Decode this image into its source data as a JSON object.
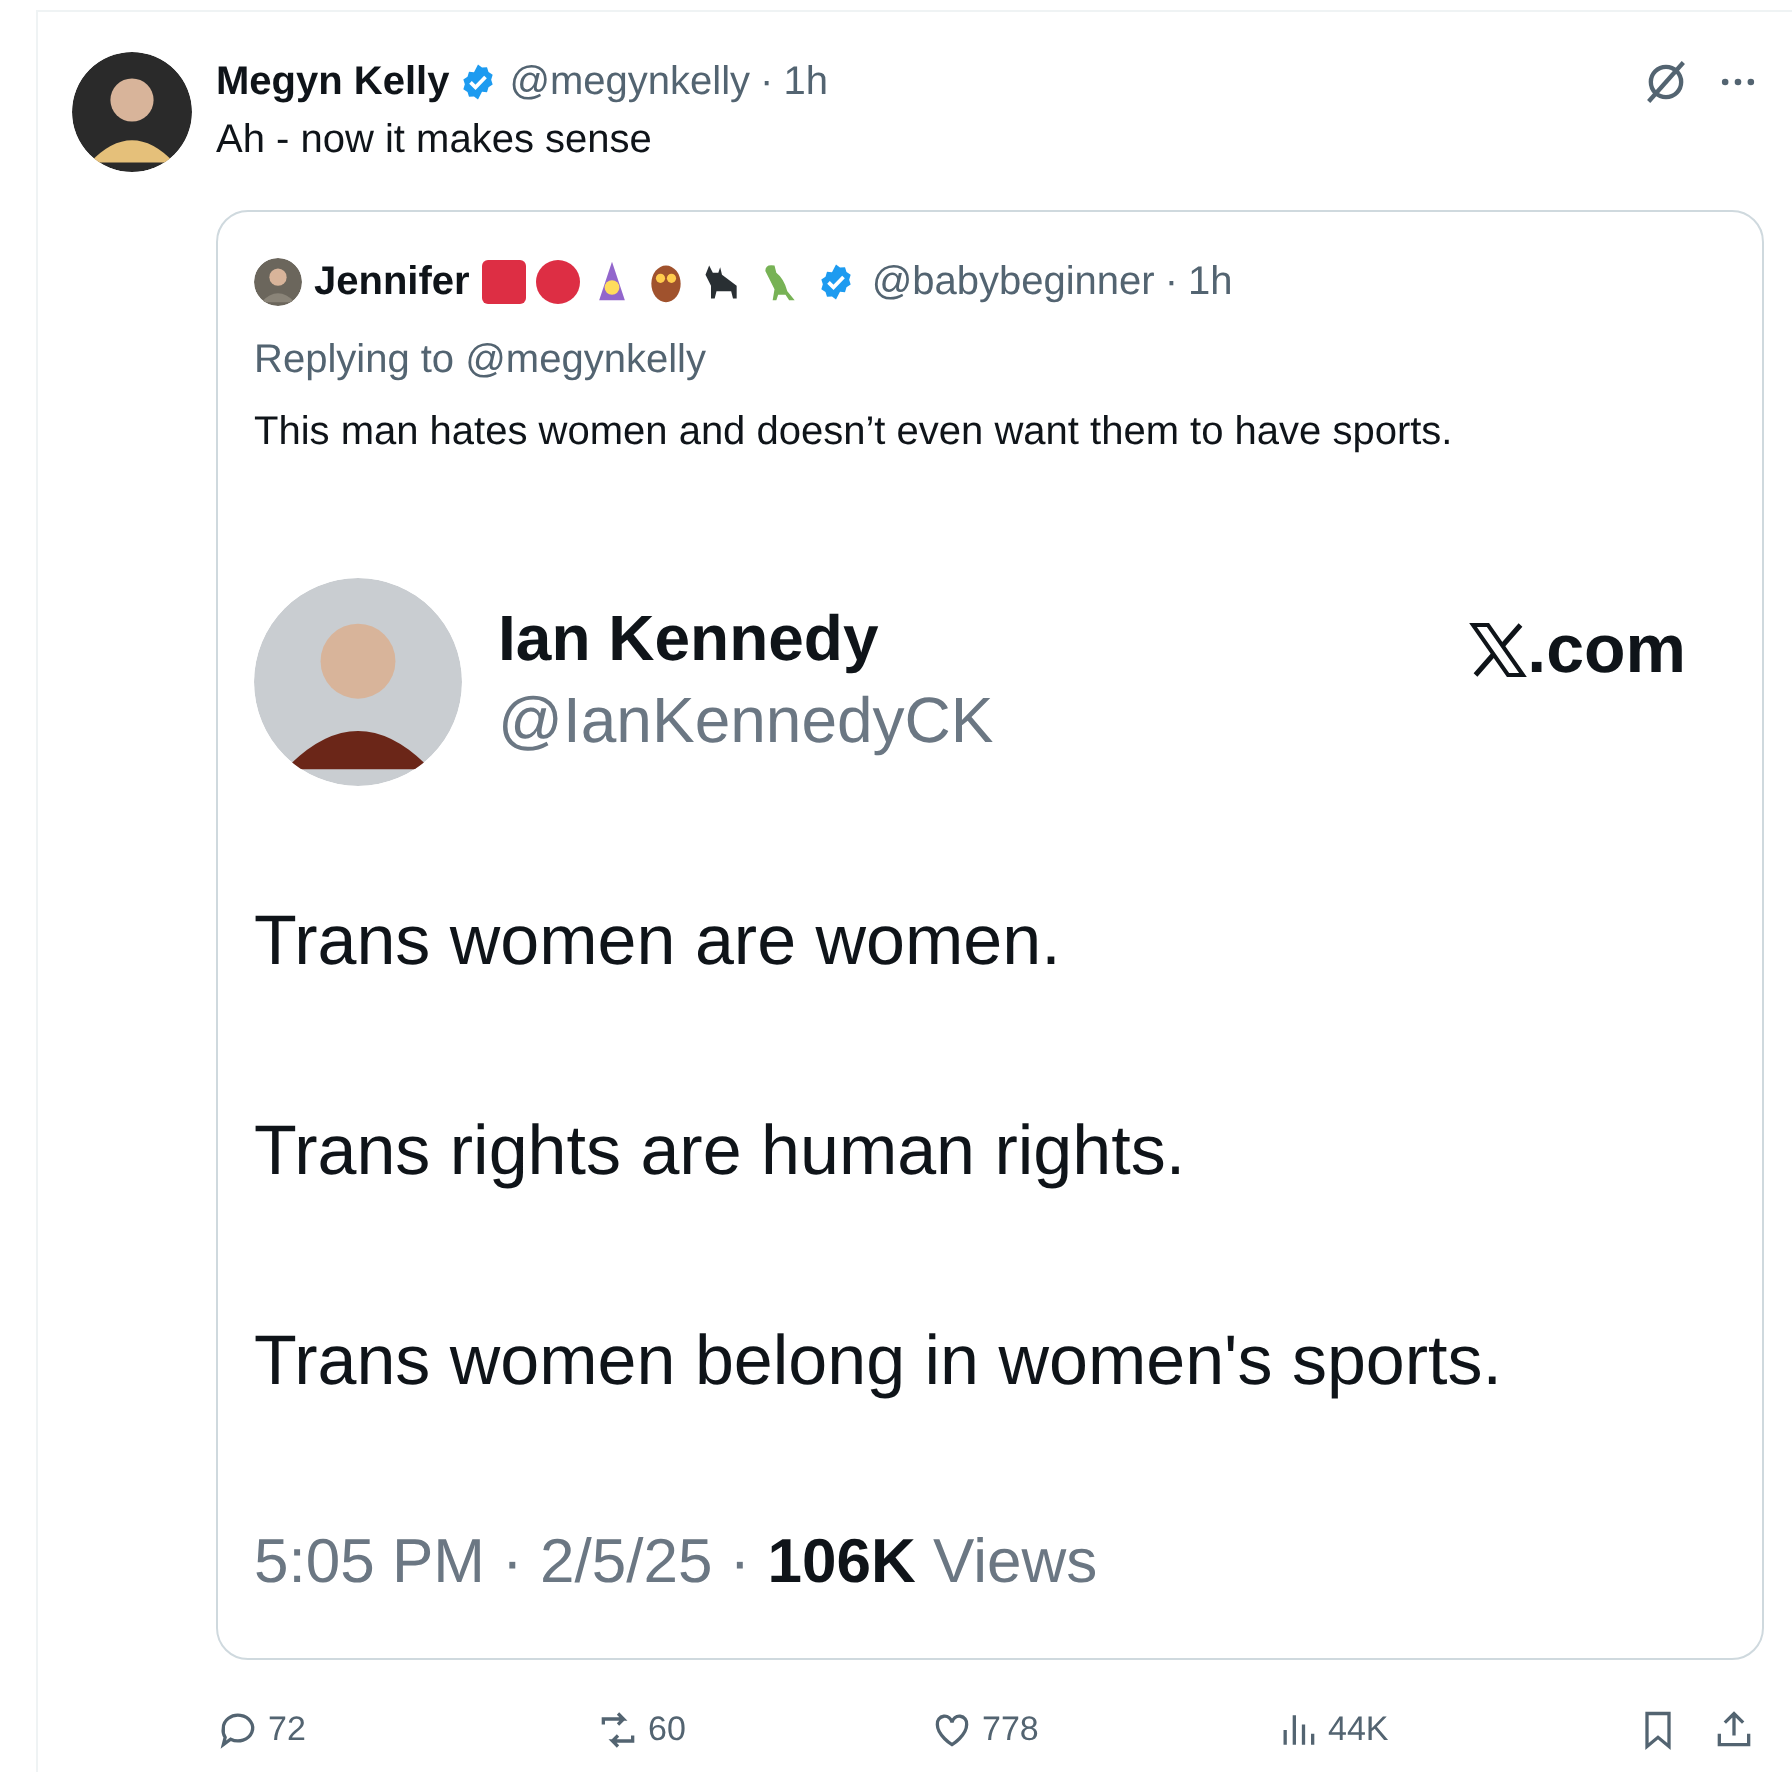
{
  "post": {
    "author": {
      "name": "Megyn Kelly",
      "verified": true,
      "handle": "@megynkelly",
      "separator": "·",
      "time": "1h"
    },
    "text": "Ah - now it makes sense",
    "quote": {
      "author": {
        "name": "Jennifer",
        "verified": true,
        "handle": "@babybeginner",
        "separator": "·",
        "time": "1h"
      },
      "replying_to": "Replying to @megynkelly",
      "text": "This man hates women and doesn’t even want them to have sports.",
      "image": {
        "name": "Ian Kennedy",
        "handle": "@IanKennedyCK",
        "site": ".com",
        "lines": [
          "Trans women are women.",
          "Trans rights are human rights.",
          "Trans women belong in women's sports."
        ],
        "timestamp": "5:05 PM · 2/5/25 · **106K** Views"
      }
    },
    "actions": [
      {
        "kind": "reply",
        "count": "72"
      },
      {
        "kind": "repost",
        "count": "60"
      },
      {
        "kind": "like",
        "count": "778"
      },
      {
        "kind": "views",
        "count": "44K"
      },
      {
        "kind": "bookmark"
      },
      {
        "kind": "share"
      }
    ]
  }
}
